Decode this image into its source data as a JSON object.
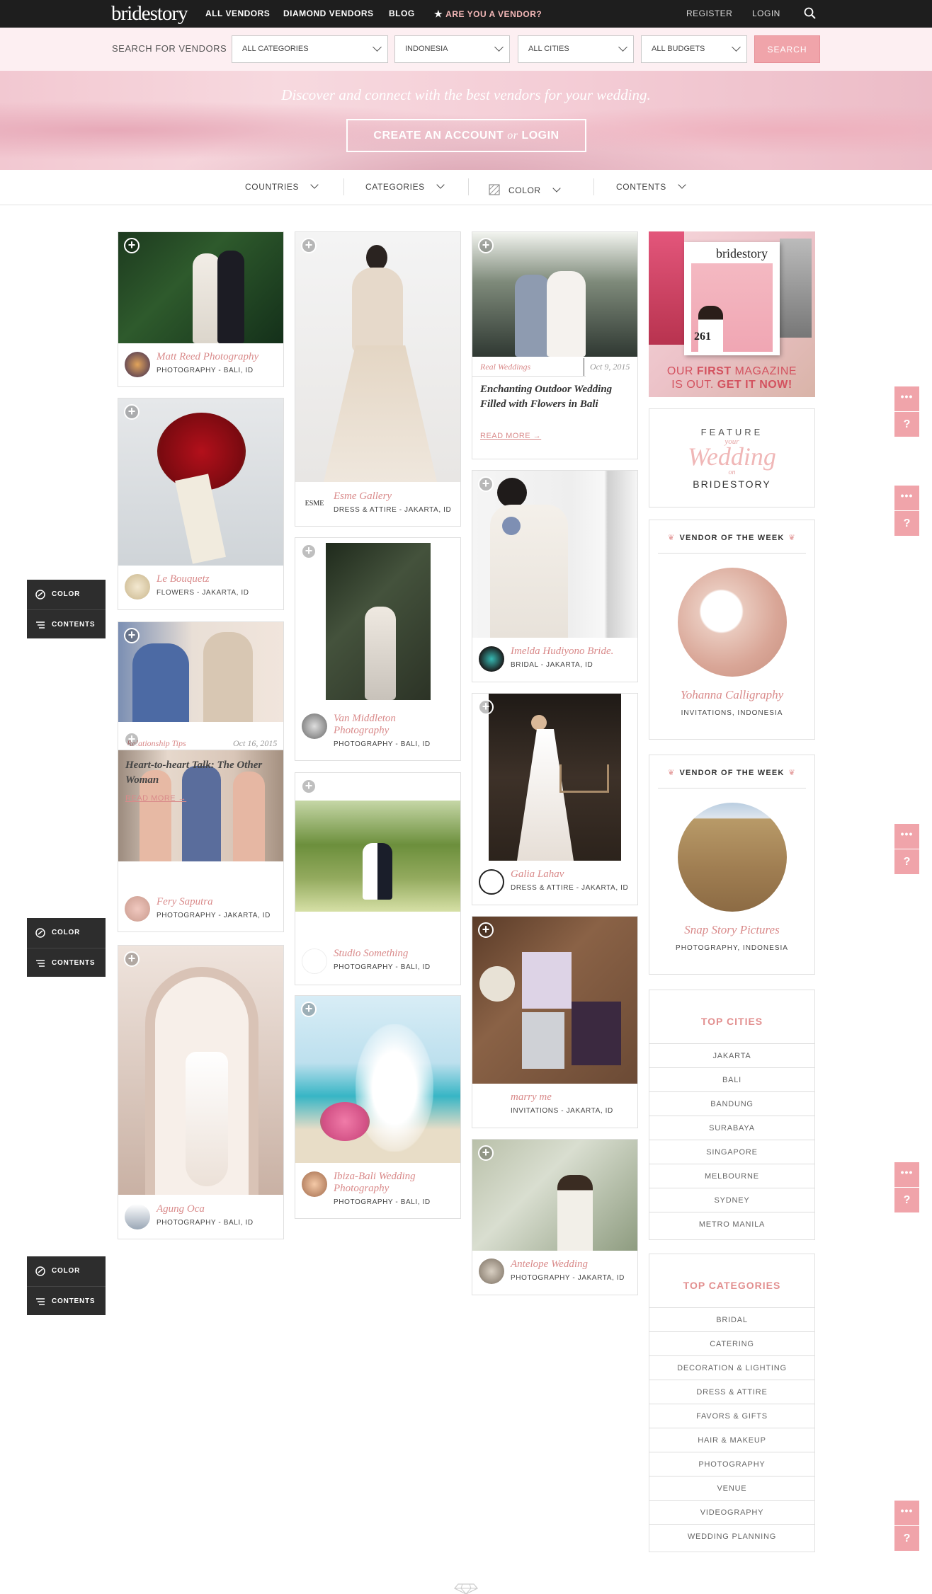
{
  "nav": {
    "logo": "bridestory",
    "all_vendors": "ALL VENDORS",
    "diamond_vendors": "DIAMOND VENDORS",
    "blog": "BLOG",
    "are_you_vendor": "ARE YOU A VENDOR?",
    "register": "REGISTER",
    "login": "LOGIN"
  },
  "search": {
    "label": "SEARCH FOR VENDORS",
    "category": "ALL CATEGORIES",
    "country": "INDONESIA",
    "city": "ALL CITIES",
    "budget": "ALL BUDGETS",
    "button": "SEARCH"
  },
  "hero": {
    "tagline": "Discover and connect with the best vendors for your wedding.",
    "cta_a": "CREATE AN ACCOUNT",
    "cta_or": "or",
    "cta_b": "LOGIN"
  },
  "filters": {
    "countries": "COUNTRIES",
    "categories": "CATEGORIES",
    "color": "COLOR",
    "contents": "CONTENTS"
  },
  "side_panel": {
    "color": "COLOR",
    "contents": "CONTENTS"
  },
  "floating": {
    "dots": "•••",
    "help": "?"
  },
  "cards": [
    {
      "name": "Matt Reed Photography",
      "meta": "PHOTOGRAPHY - BALI, ID"
    },
    {
      "name": "Le Bouquetz",
      "meta": "FLOWERS - JAKARTA, ID"
    },
    {
      "name": "Fery Saputra",
      "meta": "PHOTOGRAPHY - JAKARTA, ID"
    },
    {
      "name": "Agung Oca",
      "meta": "PHOTOGRAPHY - BALI, ID"
    },
    {
      "name": "Esme Gallery",
      "meta": "DRESS & ATTIRE - JAKARTA, ID",
      "logo": "ESME"
    },
    {
      "name": "Van Middleton Photography",
      "meta": "PHOTOGRAPHY - BALI, ID"
    },
    {
      "name": "Studio Something",
      "meta": "PHOTOGRAPHY - BALI, ID"
    },
    {
      "name": "Ibiza-Bali Wedding Photography",
      "meta": "PHOTOGRAPHY - BALI, ID"
    },
    {
      "name": "Imelda Hudiyono Bride.",
      "meta": "BRIDAL - JAKARTA, ID"
    },
    {
      "name": "Galia Lahav",
      "meta": "DRESS & ATTIRE - JAKARTA, ID"
    },
    {
      "name": "marry me",
      "meta": "INVITATIONS - JAKARTA, ID"
    },
    {
      "name": "Antelope Wedding",
      "meta": "PHOTOGRAPHY - JAKARTA, ID"
    }
  ],
  "articles": {
    "real_weddings": {
      "tag": "Real Weddings",
      "date": "Oct 9, 2015",
      "title": "Enchanting Outdoor Wedding Filled with Flowers in Bali",
      "read_more": "READ MORE →"
    },
    "relationship": {
      "tag": "Relationship Tips",
      "date": "Oct 16, 2015",
      "title": "Heart-to-heart Talk: The Other Woman",
      "read_more": "READ MORE →"
    }
  },
  "magazine": {
    "brand": "bridestory",
    "issue": "261",
    "line1_a": "OUR ",
    "line1_b": "FIRST",
    "line1_c": " MAGAZINE",
    "line2_a": "IS OUT. ",
    "line2_b": "GET IT NOW!"
  },
  "feature": {
    "top": "FEATURE",
    "your": "your",
    "wedding": "Wedding",
    "on": "on",
    "brand": "BRIDESTORY"
  },
  "vendor_of_week": [
    {
      "title": "VENDOR OF THE WEEK",
      "name": "Yohanna Calligraphy",
      "meta": "INVITATIONS, INDONESIA"
    },
    {
      "title": "VENDOR OF THE WEEK",
      "name": "Snap Story Pictures",
      "meta": "PHOTOGRAPHY, INDONESIA"
    }
  ],
  "top_cities": {
    "title": "TOP CITIES",
    "items": [
      "JAKARTA",
      "BALI",
      "BANDUNG",
      "SURABAYA",
      "SINGAPORE",
      "MELBOURNE",
      "SYDNEY",
      "METRO MANILA"
    ]
  },
  "top_categories": {
    "title": "TOP CATEGORIES",
    "items": [
      "BRIDAL",
      "CATERING",
      "DECORATION & LIGHTING",
      "DRESS & ATTIRE",
      "FAVORS & GIFTS",
      "HAIR & MAKEUP",
      "PHOTOGRAPHY",
      "VENUE",
      "VIDEOGRAPHY",
      "WEDDING PLANNING"
    ]
  }
}
